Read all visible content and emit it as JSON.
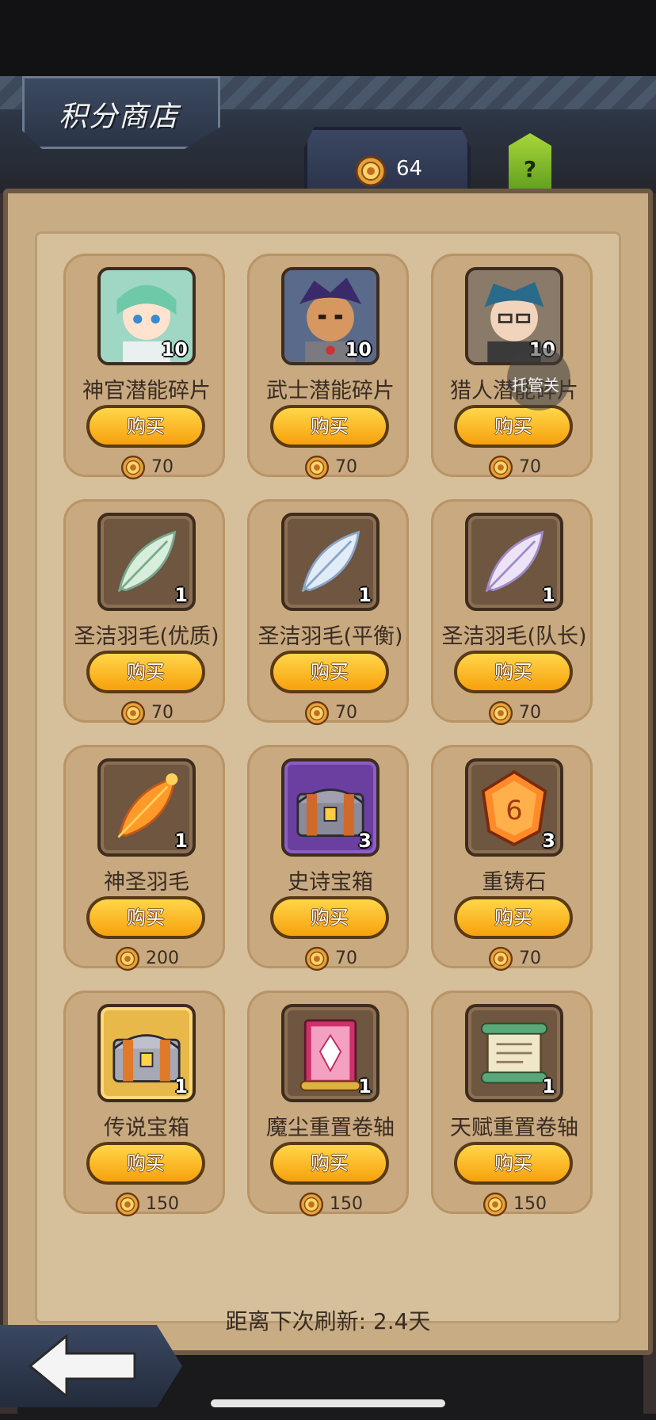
{
  "title": "积分商店",
  "points": "64",
  "help_label": "?",
  "overlay_label": "托管关",
  "buy_label": "购买",
  "items": [
    {
      "name": "神官潜能碎片",
      "qty": "10",
      "price": "70",
      "icon": "cleric-portrait-icon",
      "frame": "normal"
    },
    {
      "name": "武士潜能碎片",
      "qty": "10",
      "price": "70",
      "icon": "warrior-portrait-icon",
      "frame": "normal"
    },
    {
      "name": "猎人潜能碎片",
      "qty": "10",
      "price": "70",
      "icon": "hunter-portrait-icon",
      "frame": "normal"
    },
    {
      "name": "圣洁羽毛(优质)",
      "qty": "1",
      "price": "70",
      "icon": "green-feather-icon",
      "frame": "normal"
    },
    {
      "name": "圣洁羽毛(平衡)",
      "qty": "1",
      "price": "70",
      "icon": "blue-feather-icon",
      "frame": "normal"
    },
    {
      "name": "圣洁羽毛(队长)",
      "qty": "1",
      "price": "70",
      "icon": "purple-feather-icon",
      "frame": "normal"
    },
    {
      "name": "神圣羽毛",
      "qty": "1",
      "price": "200",
      "icon": "golden-feather-icon",
      "frame": "normal"
    },
    {
      "name": "史诗宝箱",
      "qty": "3",
      "price": "70",
      "icon": "epic-chest-icon",
      "frame": "purple"
    },
    {
      "name": "重铸石",
      "qty": "3",
      "price": "70",
      "icon": "reforge-stone-icon",
      "frame": "normal"
    },
    {
      "name": "传说宝箱",
      "qty": "1",
      "price": "150",
      "icon": "legendary-chest-icon",
      "frame": "gold"
    },
    {
      "name": "魔尘重置卷轴",
      "qty": "1",
      "price": "150",
      "icon": "magic-dust-scroll-icon",
      "frame": "normal"
    },
    {
      "name": "天赋重置卷轴",
      "qty": "1",
      "price": "150",
      "icon": "talent-scroll-icon",
      "frame": "normal"
    }
  ],
  "refresh_text": "距离下次刷新: 2.4天",
  "back_icon": "back-arrow-icon"
}
